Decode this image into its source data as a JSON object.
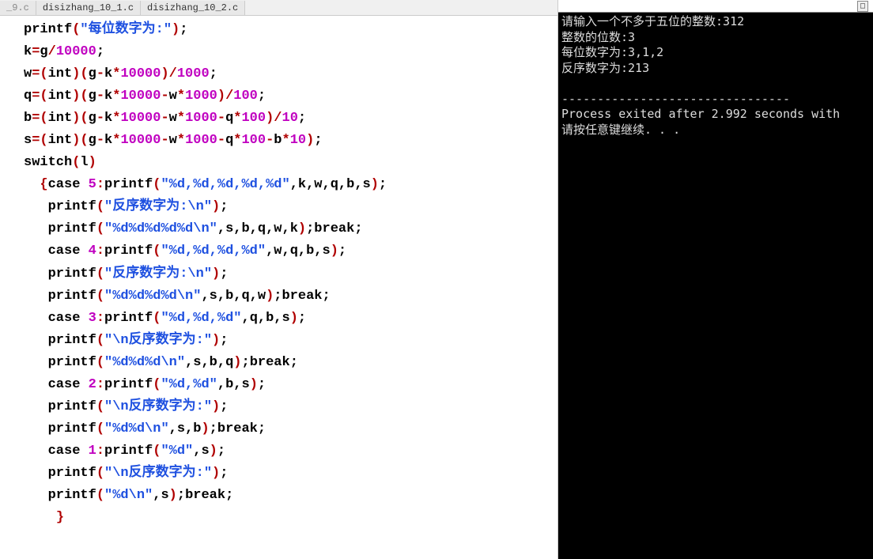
{
  "tabs": {
    "t0": "_9.c",
    "t1": "disizhang_10_1.c",
    "t2": "disizhang_10_2.c"
  },
  "code": {
    "l1_fn": "printf",
    "l1_str": "\"每位数字为:\"",
    "l2_a": "k",
    "l2_b": "g",
    "l2_c": "10000",
    "l3_a": "w",
    "l3_cast": "int",
    "l3_g": "g",
    "l3_k": "k",
    "l3_10000": "10000",
    "l3_1000": "1000",
    "l4_a": "q",
    "l4_100": "100",
    "l5_a": "b",
    "l5_10": "10",
    "l6_a": "s",
    "switch": "switch",
    "lvar": "l",
    "case": "case",
    "c5": "5",
    "c4": "4",
    "c3": "3",
    "c2": "2",
    "c1": "1",
    "printf": "printf",
    "fmt5": "\"%d,%d,%d,%d,%d\"",
    "rev_nl": "\"反序数字为:\\n\"",
    "fmt5b": "\"%d%d%d%d%d\\n\"",
    "break": "break",
    "fmt4": "\"%d,%d,%d,%d\"",
    "fmt4b": "\"%d%d%d%d\\n\"",
    "fmt3": "\"%d,%d,%d\"",
    "rev_nl2": "\"\\n反序数字为:\"",
    "fmt3b": "\"%d%d%d\\n\"",
    "fmt2": "\"%d,%d\"",
    "fmt2b": "\"%d%d\\n\"",
    "fmt1": "\"%d\"",
    "fmt1b": "\"%d\\n\"",
    "k": "k",
    "w": "w",
    "q": "q",
    "b": "b",
    "s": "s"
  },
  "console": {
    "l1": "请输入一个不多于五位的整数:312",
    "l2": "整数的位数:3",
    "l3": "每位数字为:3,1,2",
    "l4": "反序数字为:213",
    "sep": "--------------------------------",
    "l5": "Process exited after 2.992 seconds with",
    "l6": "请按任意键继续. . ."
  }
}
